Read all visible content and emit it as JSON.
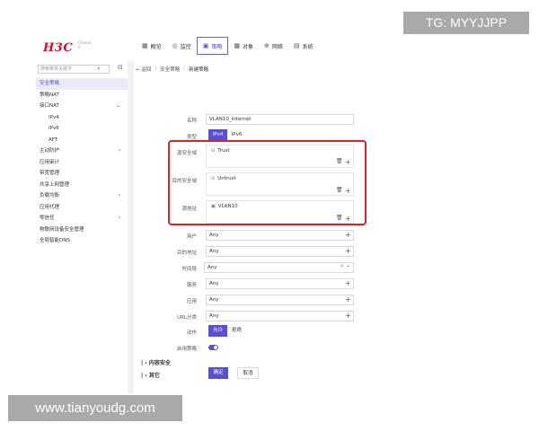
{
  "brand": {
    "logo": "H3C",
    "chassis": "Chassis\n0"
  },
  "nav": [
    {
      "icon": "▦",
      "icon_name": "overview-icon",
      "label": "概览"
    },
    {
      "icon": "◎",
      "icon_name": "monitor-icon",
      "label": "监控"
    },
    {
      "icon": "▣",
      "icon_name": "policy-icon",
      "label": "策略",
      "active": true
    },
    {
      "icon": "▦",
      "icon_name": "object-icon",
      "label": "对象"
    },
    {
      "icon": "⊕",
      "icon_name": "network-icon",
      "label": "网络"
    },
    {
      "icon": "▤",
      "icon_name": "system-icon",
      "label": "系统"
    }
  ],
  "sidebar": {
    "search_placeholder": "搜索菜单关键字",
    "items": [
      {
        "label": "安全策略",
        "active": true,
        "sub": false,
        "chevron": ""
      },
      {
        "label": "策略NAT",
        "sub": false,
        "chevron": ""
      },
      {
        "label": "接口NAT",
        "sub": false,
        "chevron": "⌄"
      },
      {
        "label": "IPv4",
        "sub": true,
        "chevron": ""
      },
      {
        "label": "IPv6",
        "sub": true,
        "chevron": ""
      },
      {
        "label": "AFT",
        "sub": true,
        "chevron": ""
      },
      {
        "label": "主动防护",
        "sub": false,
        "chevron": "›"
      },
      {
        "label": "应用审计",
        "sub": false,
        "chevron": ""
      },
      {
        "label": "带宽管理",
        "sub": false,
        "chevron": ""
      },
      {
        "label": "共享上网管理",
        "sub": false,
        "chevron": ""
      },
      {
        "label": "负载均衡",
        "sub": false,
        "chevron": "›"
      },
      {
        "label": "应用代理",
        "sub": false,
        "chevron": ""
      },
      {
        "label": "零信任",
        "sub": false,
        "chevron": "›"
      },
      {
        "label": "物联网设备安全管理",
        "sub": false,
        "chevron": ""
      },
      {
        "label": "全局智能DNS",
        "sub": false,
        "chevron": ""
      }
    ]
  },
  "breadcrumb": {
    "back": "← 返回",
    "parent": "安全策略",
    "current": "新建策略"
  },
  "form": {
    "name": {
      "label": "名称",
      "value": "VLAN10_Internet"
    },
    "type": {
      "label": "类型",
      "options": [
        "IPv4",
        "IPv6"
      ],
      "selected": "IPv4"
    },
    "src_zone": {
      "label": "源安全域",
      "value": "Trust"
    },
    "dst_zone": {
      "label": "目的安全域",
      "value": "Untrust"
    },
    "src_addr": {
      "label": "源地址",
      "value": "VLAN10"
    },
    "user": {
      "label": "用户",
      "value": "Any"
    },
    "dst_addr": {
      "label": "目的地址",
      "value": "Any"
    },
    "time_range": {
      "label": "时间段",
      "value": "Any"
    },
    "service": {
      "label": "服务",
      "value": "Any"
    },
    "application": {
      "label": "应用",
      "value": "Any"
    },
    "url_category": {
      "label": "URL分类",
      "value": "Any"
    },
    "action": {
      "label": "动作",
      "options": [
        "允许",
        "拒绝"
      ],
      "selected": "允许"
    },
    "enable": {
      "label": "启用策略",
      "enabled": true
    }
  },
  "sections": {
    "content_security": "内容安全",
    "other": "其它"
  },
  "buttons": {
    "ok": "确定",
    "cancel": "取消"
  },
  "overlays": {
    "top": "TG: MYYJJPP",
    "bottom": "www.tianyoudg.com"
  },
  "colors": {
    "accent": "#5a4fcf",
    "highlight_box": "#d7232e",
    "logo": "#c8102e"
  }
}
